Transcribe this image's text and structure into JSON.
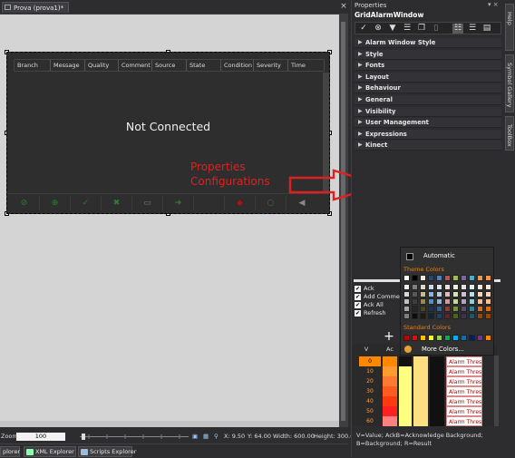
{
  "document": {
    "tab_label": "Prova (prova1)*",
    "close_glyph": "×",
    "alarm_window": {
      "columns": [
        "Branch",
        "Message",
        "Quality",
        "Comment",
        "Source",
        "State",
        "Condition",
        "Severity",
        "Time"
      ],
      "status_text": "Not Connected",
      "toolbar_icons": [
        "check-icon",
        "check-all-icon",
        "reset-icon",
        "close-alarm-icon",
        "comment-icon",
        "arrow-right-icon",
        "blank-icon",
        "remove-icon",
        "snooze-icon",
        "mute-icon"
      ]
    },
    "annotation": {
      "line1": "Properties",
      "line2": "Configurations",
      "color": "#e02020"
    }
  },
  "status_bar": {
    "zoom_label": "Zoom",
    "zoom_value": "100",
    "x_readout": "X: 9.50",
    "y_readout": "Y: 64.00",
    "width_readout": "Width: 600.00",
    "height_readout": "Height: 300.0"
  },
  "bottom_tabs": [
    {
      "label": "plorer"
    },
    {
      "label": "XML Explorer"
    },
    {
      "label": "Scripts Explorer"
    }
  ],
  "properties": {
    "title": "Properties",
    "pin_glyph": "▾ ×",
    "object_name": "GridAlarmWindow",
    "categories": [
      "Alarm Window Style",
      "Style",
      "Fonts",
      "Layout",
      "Behaviour",
      "General",
      "Visibility",
      "User Management",
      "Expressions",
      "Kinect"
    ],
    "checkboxes": [
      {
        "label": "Ack",
        "checked": true
      },
      {
        "label": "Add Comment",
        "checked": true
      },
      {
        "label": "Ack All",
        "checked": true
      },
      {
        "label": "Refresh",
        "checked": true
      }
    ],
    "add_glyph": "+",
    "table": {
      "headers": [
        "V",
        "Ac"
      ],
      "rows": [
        {
          "v": "0",
          "text": "Alarm Threshold",
          "color": "#ff8800"
        },
        {
          "v": "10",
          "text": "Alarm Threshold",
          "color": "#ff9a30"
        },
        {
          "v": "20",
          "text": "Alarm Threshold",
          "color": "#ff7a30"
        },
        {
          "v": "30",
          "text": "Alarm Threshold",
          "color": "#ff5a20"
        },
        {
          "v": "40",
          "text": "Alarm Threshold",
          "color": "#ff3a10"
        },
        {
          "v": "50",
          "text": "Alarm Threshold",
          "color": "#ff2020"
        },
        {
          "v": "60",
          "text": "Alarm Threshold",
          "color": "#ff8080"
        }
      ]
    },
    "footer_text": "V=Value; AckB=Acknowledge Background; B=Background; R=Result"
  },
  "color_picker": {
    "automatic_label": "Automatic",
    "theme_label": "Theme Colors",
    "standard_label": "Standard Colors",
    "more_label": "More Colors...",
    "theme_top": [
      "#ffffff",
      "#000000",
      "#eeece1",
      "#1f497d",
      "#4f81bd",
      "#c0504d",
      "#9bbb59",
      "#8064a2",
      "#4bacc6",
      "#f79646",
      "#f79646"
    ],
    "theme_columns": [
      [
        "#f2f2f2",
        "#d8d8d8",
        "#bfbfbf",
        "#a5a5a5",
        "#7f7f7f"
      ],
      [
        "#7f7f7f",
        "#595959",
        "#3f3f3f",
        "#262626",
        "#0c0c0c"
      ],
      [
        "#ddd9c3",
        "#c4bd97",
        "#938953",
        "#494429",
        "#1d1b10"
      ],
      [
        "#c6d9f0",
        "#8db3e2",
        "#548dd4",
        "#17365d",
        "#0f243e"
      ],
      [
        "#dbe5f1",
        "#b8cce4",
        "#95b3d7",
        "#366092",
        "#244061"
      ],
      [
        "#f2dcdb",
        "#e5b9b7",
        "#d99694",
        "#953734",
        "#632423"
      ],
      [
        "#ebf1dd",
        "#d7e3bc",
        "#c3d69b",
        "#76923c",
        "#4f6128"
      ],
      [
        "#e5e0ec",
        "#ccc1d9",
        "#b2a2c7",
        "#5f497a",
        "#3f3151"
      ],
      [
        "#dbeef3",
        "#b7dde8",
        "#92cddc",
        "#31859b",
        "#205867"
      ],
      [
        "#fdeada",
        "#fbd5b5",
        "#fac08f",
        "#e36c09",
        "#974806"
      ],
      [
        "#fdeada",
        "#fbd5b5",
        "#fac08f",
        "#e36c09",
        "#974806"
      ]
    ],
    "standard": [
      "#c00000",
      "#ff0000",
      "#ffc000",
      "#ffff00",
      "#92d050",
      "#00b050",
      "#00b0f0",
      "#0070c0",
      "#002060",
      "#7030a0",
      "#ff8800"
    ]
  },
  "side_tabs": [
    "Context Help",
    "Symbol Gallery",
    "ToolBox"
  ]
}
